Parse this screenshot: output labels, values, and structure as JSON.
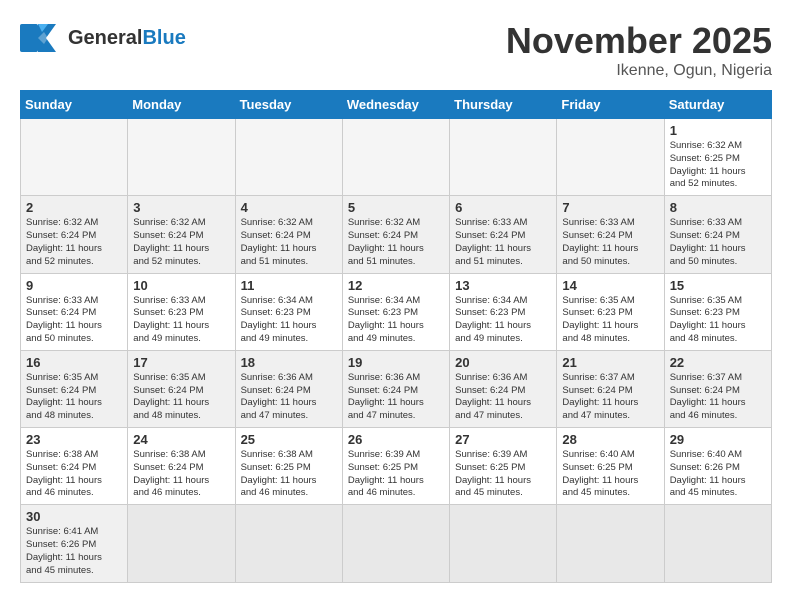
{
  "header": {
    "logo_general": "General",
    "logo_blue": "Blue",
    "month_title": "November 2025",
    "location": "Ikenne, Ogun, Nigeria"
  },
  "columns": [
    "Sunday",
    "Monday",
    "Tuesday",
    "Wednesday",
    "Thursday",
    "Friday",
    "Saturday"
  ],
  "weeks": [
    {
      "days": [
        {
          "num": "",
          "info": "",
          "empty": true
        },
        {
          "num": "",
          "info": "",
          "empty": true
        },
        {
          "num": "",
          "info": "",
          "empty": true
        },
        {
          "num": "",
          "info": "",
          "empty": true
        },
        {
          "num": "",
          "info": "",
          "empty": true
        },
        {
          "num": "",
          "info": "",
          "empty": true
        },
        {
          "num": "1",
          "info": "Sunrise: 6:32 AM\nSunset: 6:25 PM\nDaylight: 11 hours\nand 52 minutes."
        }
      ]
    },
    {
      "shade": true,
      "days": [
        {
          "num": "2",
          "info": "Sunrise: 6:32 AM\nSunset: 6:24 PM\nDaylight: 11 hours\nand 52 minutes."
        },
        {
          "num": "3",
          "info": "Sunrise: 6:32 AM\nSunset: 6:24 PM\nDaylight: 11 hours\nand 52 minutes."
        },
        {
          "num": "4",
          "info": "Sunrise: 6:32 AM\nSunset: 6:24 PM\nDaylight: 11 hours\nand 51 minutes."
        },
        {
          "num": "5",
          "info": "Sunrise: 6:32 AM\nSunset: 6:24 PM\nDaylight: 11 hours\nand 51 minutes."
        },
        {
          "num": "6",
          "info": "Sunrise: 6:33 AM\nSunset: 6:24 PM\nDaylight: 11 hours\nand 51 minutes."
        },
        {
          "num": "7",
          "info": "Sunrise: 6:33 AM\nSunset: 6:24 PM\nDaylight: 11 hours\nand 50 minutes."
        },
        {
          "num": "8",
          "info": "Sunrise: 6:33 AM\nSunset: 6:24 PM\nDaylight: 11 hours\nand 50 minutes."
        }
      ]
    },
    {
      "days": [
        {
          "num": "9",
          "info": "Sunrise: 6:33 AM\nSunset: 6:24 PM\nDaylight: 11 hours\nand 50 minutes."
        },
        {
          "num": "10",
          "info": "Sunrise: 6:33 AM\nSunset: 6:23 PM\nDaylight: 11 hours\nand 49 minutes."
        },
        {
          "num": "11",
          "info": "Sunrise: 6:34 AM\nSunset: 6:23 PM\nDaylight: 11 hours\nand 49 minutes."
        },
        {
          "num": "12",
          "info": "Sunrise: 6:34 AM\nSunset: 6:23 PM\nDaylight: 11 hours\nand 49 minutes."
        },
        {
          "num": "13",
          "info": "Sunrise: 6:34 AM\nSunset: 6:23 PM\nDaylight: 11 hours\nand 49 minutes."
        },
        {
          "num": "14",
          "info": "Sunrise: 6:35 AM\nSunset: 6:23 PM\nDaylight: 11 hours\nand 48 minutes."
        },
        {
          "num": "15",
          "info": "Sunrise: 6:35 AM\nSunset: 6:23 PM\nDaylight: 11 hours\nand 48 minutes."
        }
      ]
    },
    {
      "shade": true,
      "days": [
        {
          "num": "16",
          "info": "Sunrise: 6:35 AM\nSunset: 6:24 PM\nDaylight: 11 hours\nand 48 minutes."
        },
        {
          "num": "17",
          "info": "Sunrise: 6:35 AM\nSunset: 6:24 PM\nDaylight: 11 hours\nand 48 minutes."
        },
        {
          "num": "18",
          "info": "Sunrise: 6:36 AM\nSunset: 6:24 PM\nDaylight: 11 hours\nand 47 minutes."
        },
        {
          "num": "19",
          "info": "Sunrise: 6:36 AM\nSunset: 6:24 PM\nDaylight: 11 hours\nand 47 minutes."
        },
        {
          "num": "20",
          "info": "Sunrise: 6:36 AM\nSunset: 6:24 PM\nDaylight: 11 hours\nand 47 minutes."
        },
        {
          "num": "21",
          "info": "Sunrise: 6:37 AM\nSunset: 6:24 PM\nDaylight: 11 hours\nand 47 minutes."
        },
        {
          "num": "22",
          "info": "Sunrise: 6:37 AM\nSunset: 6:24 PM\nDaylight: 11 hours\nand 46 minutes."
        }
      ]
    },
    {
      "days": [
        {
          "num": "23",
          "info": "Sunrise: 6:38 AM\nSunset: 6:24 PM\nDaylight: 11 hours\nand 46 minutes."
        },
        {
          "num": "24",
          "info": "Sunrise: 6:38 AM\nSunset: 6:24 PM\nDaylight: 11 hours\nand 46 minutes."
        },
        {
          "num": "25",
          "info": "Sunrise: 6:38 AM\nSunset: 6:25 PM\nDaylight: 11 hours\nand 46 minutes."
        },
        {
          "num": "26",
          "info": "Sunrise: 6:39 AM\nSunset: 6:25 PM\nDaylight: 11 hours\nand 46 minutes."
        },
        {
          "num": "27",
          "info": "Sunrise: 6:39 AM\nSunset: 6:25 PM\nDaylight: 11 hours\nand 45 minutes."
        },
        {
          "num": "28",
          "info": "Sunrise: 6:40 AM\nSunset: 6:25 PM\nDaylight: 11 hours\nand 45 minutes."
        },
        {
          "num": "29",
          "info": "Sunrise: 6:40 AM\nSunset: 6:26 PM\nDaylight: 11 hours\nand 45 minutes."
        }
      ]
    },
    {
      "shade": true,
      "days": [
        {
          "num": "30",
          "info": "Sunrise: 6:41 AM\nSunset: 6:26 PM\nDaylight: 11 hours\nand 45 minutes."
        },
        {
          "num": "",
          "info": "",
          "empty": true
        },
        {
          "num": "",
          "info": "",
          "empty": true
        },
        {
          "num": "",
          "info": "",
          "empty": true
        },
        {
          "num": "",
          "info": "",
          "empty": true
        },
        {
          "num": "",
          "info": "",
          "empty": true
        },
        {
          "num": "",
          "info": "",
          "empty": true
        }
      ]
    }
  ]
}
